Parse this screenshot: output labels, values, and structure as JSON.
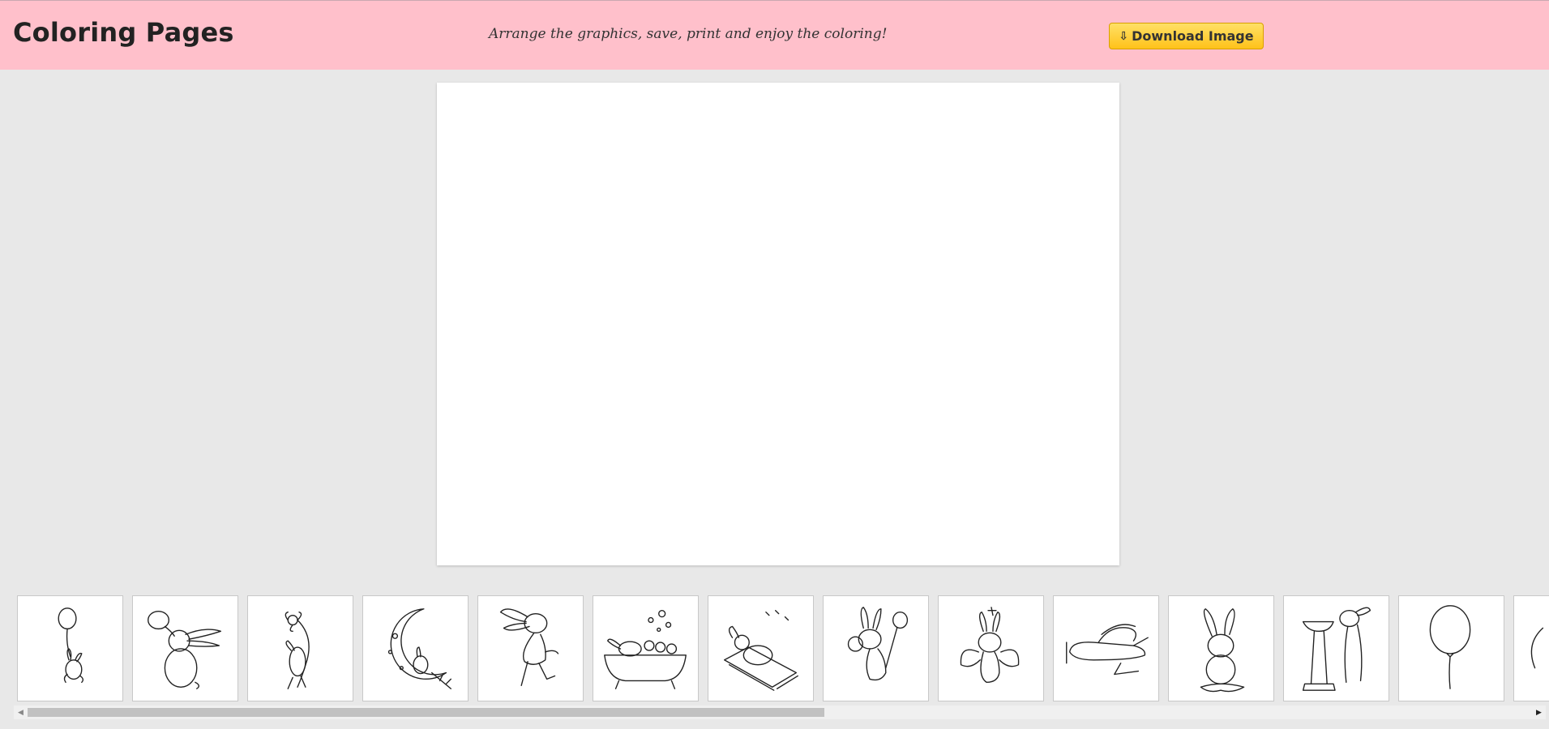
{
  "header": {
    "title": "Coloring Pages",
    "tagline": "Arrange the graphics, save, print and enjoy the coloring!",
    "download_label": "Download Image",
    "download_icon": "⇩",
    "background_color": "#ffc0cb",
    "button_color": "#ffcc33"
  },
  "canvas": {
    "background_color": "#ffffff"
  },
  "gallery": {
    "thumbnails": [
      {
        "icon": "bunny-with-balloon-icon"
      },
      {
        "icon": "bunny-holding-balloon-icon"
      },
      {
        "icon": "bunny-with-flower-icon"
      },
      {
        "icon": "bunny-on-moon-icon"
      },
      {
        "icon": "dancing-bunny-icon"
      },
      {
        "icon": "bunny-in-bathtub-icon"
      },
      {
        "icon": "bunny-on-sled-icon"
      },
      {
        "icon": "bunny-with-magnifier-and-net-icon"
      },
      {
        "icon": "fairy-bunny-icon"
      },
      {
        "icon": "bunny-in-airplane-icon"
      },
      {
        "icon": "sitting-bunny-icon"
      },
      {
        "icon": "bunny-at-birdbath-icon"
      },
      {
        "icon": "balloon-icon"
      },
      {
        "icon": "partial-drawing-icon"
      }
    ]
  }
}
